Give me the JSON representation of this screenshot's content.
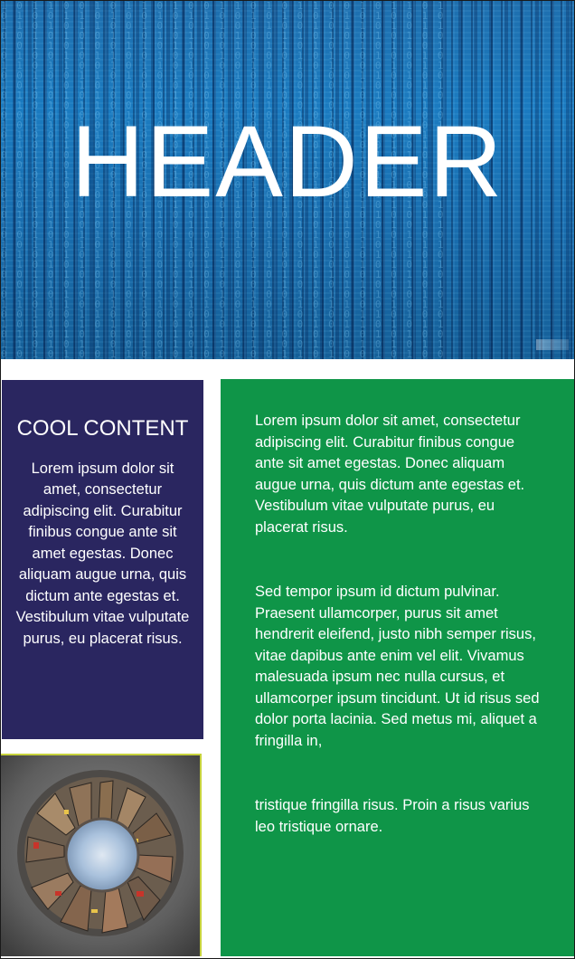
{
  "header": {
    "title": "HEADER",
    "background": "#1b7bc0"
  },
  "left_card": {
    "title": "COOL CONTENT",
    "body": "Lorem ipsum dolor sit amet, consectetur adipiscing elit. Curabitur finibus congue ante sit amet egestas. Donec aliquam augue urna, quis dictum ante egestas et. Vestibulum vitae vulputate purus, eu placerat risus.",
    "background": "#2a2660"
  },
  "image": {
    "icon": "little-planet-city-image"
  },
  "right_panel": {
    "background": "#0f9548",
    "paragraphs": [
      "Lorem ipsum dolor sit amet, consectetur adipiscing elit. Curabitur finibus congue ante sit amet egestas. Donec aliquam augue urna, quis dictum ante egestas et. Vestibulum vitae vulputate purus, eu placerat risus.",
      "Sed tempor ipsum id dictum pulvinar. Praesent ullamcorper, purus sit amet hendrerit eleifend, justo nibh semper risus, vitae dapibus ante enim vel elit. Vivamus malesuada ipsum nec nulla cursus, et ullamcorper ipsum tincidunt. Ut id risus sed dolor porta lacinia. Sed metus mi, aliquet a fringilla in,",
      "tristique fringilla risus. Proin a risus varius leo tristique ornare."
    ]
  }
}
